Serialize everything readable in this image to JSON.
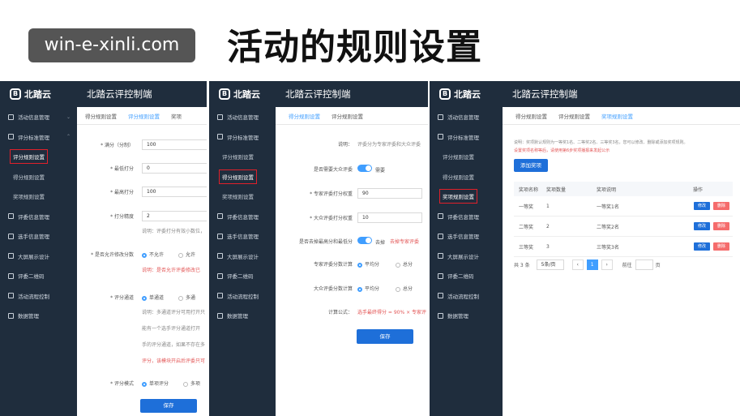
{
  "watermark": "win-e-xinli.com",
  "title": "活动的规则设置",
  "app_name": "北踏云",
  "app_title": "北踏云评控制端",
  "sidebar_items": [
    "活动信息管理",
    "评分标准管理",
    "评分规则设置",
    "得分规则设置",
    "奖项规则设置",
    "评委信息管理",
    "选手信息管理",
    "大屏展示设计",
    "评委二维码",
    "活动流程控制",
    "数据管理"
  ],
  "shot1": {
    "tabs": [
      "得分规则设置",
      "评分规则设置",
      "奖项"
    ],
    "fields": [
      {
        "label": "* 满分（分制）",
        "value": "100"
      },
      {
        "label": "* 最低打分",
        "value": "0"
      },
      {
        "label": "* 最高打分",
        "value": "100"
      },
      {
        "label": "* 打分精度",
        "value": "2"
      }
    ],
    "note1": "说明：评委打分有效小数位，",
    "penalty_label": "* 是否允许修改分数",
    "penalty_opts": [
      "不允许",
      "允许"
    ],
    "penalty_note": "说明：是否允许评委修改已",
    "channel_label": "* 评分通道",
    "channel_opts": [
      "单通道",
      "多通"
    ],
    "channel_notes": [
      "说明：多通道评分可用打开只",
      "能有一个选手评分通道打开",
      "手的评分通道，如果不存在多"
    ],
    "channel_note_red": "评分，该模块开启后评委只可",
    "mode_label": "* 评分模式",
    "mode_opts": [
      "单项评分",
      "多项"
    ],
    "save": "保存"
  },
  "shot2": {
    "tabs": [
      "得分规则设置",
      "评分规则设置"
    ],
    "desc_label": "说明：",
    "desc_value": "评委分为专家评委和大众评委",
    "f1_label": "是否需要大众评委",
    "f1_value": "需要",
    "f2_label": "* 专家评委打分权重",
    "f2_value": "90",
    "f3_label": "* 大众评委打分权重",
    "f3_value": "10",
    "f4_label": "是否去掉最高分和最低分",
    "f4_value": "去掉",
    "f4_note": "去掉专家评委",
    "f5_label": "专家评委分数计算",
    "f5_opts": [
      "平均分",
      "总分"
    ],
    "f6_label": "大众评委分数计算",
    "f6_opts": [
      "平均分",
      "总分"
    ],
    "formula_label": "计算公式：",
    "formula_value": "选手最终得分 = 90% × 专家评",
    "save": "保存"
  },
  "shot3": {
    "tabs": [
      "得分规则设置",
      "评分规则设置",
      "奖项规则设置"
    ],
    "note": "说明：奖项默认规则为一等奖1名、二等奖2名、三等奖3名，您可以修改、删除或添加奖项规则。",
    "note_red": "设置奖项名称等后，请使用第6步奖项播报来发起公示",
    "add_btn": "添加奖项",
    "headers": [
      "奖项名称",
      "奖项数量",
      "奖项说明",
      "操作"
    ],
    "rows": [
      {
        "name": "一等奖",
        "count": "1",
        "desc": "一等奖1名"
      },
      {
        "name": "二等奖",
        "count": "2",
        "desc": "二等奖2名"
      },
      {
        "name": "三等奖",
        "count": "3",
        "desc": "三等奖3名"
      }
    ],
    "edit": "修改",
    "del": "删除",
    "total": "共 3 条",
    "page_size": "5条/页",
    "page_cur": "1",
    "goto": "前往",
    "page_unit": "页"
  },
  "colors": {
    "sidebar": "#1f2d3d",
    "accent": "#409eff",
    "button": "#1e6fd9",
    "danger": "#f56c6c",
    "highlight": "#e0202a"
  }
}
